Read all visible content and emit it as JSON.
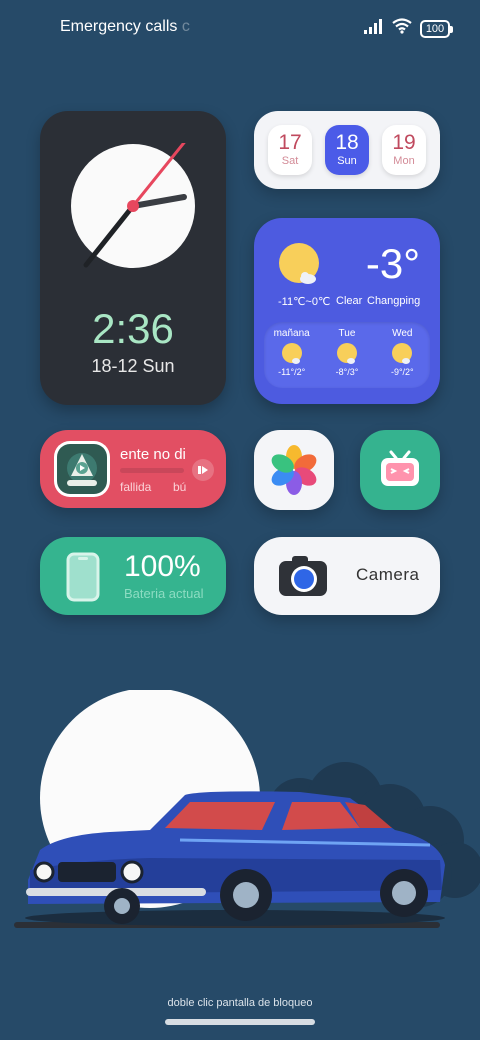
{
  "status_bar": {
    "carrier_text": "Emergency calls ",
    "carrier_overflow": "c",
    "battery_level": "100",
    "icons": [
      "signal-icon",
      "wifi-icon",
      "battery-icon"
    ]
  },
  "clock_widget": {
    "time": "2:36",
    "date": "18-12 Sun",
    "accent_color": "#e7475e",
    "time_color": "#a9e6c4"
  },
  "calendar_widget": {
    "days": [
      {
        "num": "17",
        "dow": "Sat",
        "active": false
      },
      {
        "num": "18",
        "dow": "Sun",
        "active": true
      },
      {
        "num": "19",
        "dow": "Mon",
        "active": false
      }
    ],
    "active_color": "#4b5be8"
  },
  "weather_widget": {
    "temperature": "-3°",
    "range": "-11℃~0℃",
    "condition": "Clear",
    "location": "Changping",
    "forecast": [
      {
        "day": "mañana",
        "temp": "-11°/2°"
      },
      {
        "day": "Tue",
        "temp": "-8°/3°"
      },
      {
        "day": "Wed",
        "temp": "-9°/2°"
      }
    ],
    "background_color": "#4d5be0"
  },
  "music_widget": {
    "title": "ente no dis",
    "artist_part1": "fallida",
    "artist_part2": "bú",
    "background_color": "#e24f63"
  },
  "apps": {
    "photos": {
      "name": "photos-app-icon"
    },
    "tv": {
      "name": "tv-app-icon"
    }
  },
  "battery_widget": {
    "level": "100%",
    "label": "Bateria actual",
    "background_color": "#35b48f"
  },
  "camera_widget": {
    "label": "Camera"
  },
  "footer": {
    "lock_hint": "doble clic pantalla de bloqueo"
  }
}
